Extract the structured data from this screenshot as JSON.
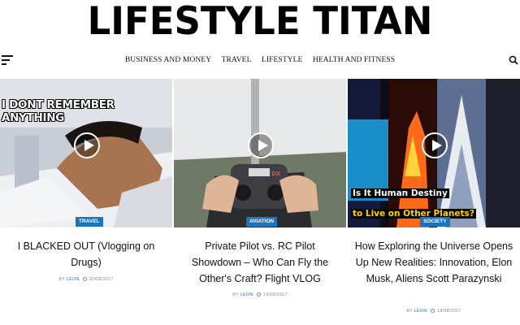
{
  "site": {
    "logo": "LIFESTYLE TITAN"
  },
  "nav": {
    "items": [
      {
        "label": "BUSINESS AND MONEY"
      },
      {
        "label": "TRAVEL"
      },
      {
        "label": "LIFESTYLE"
      },
      {
        "label": "HEALTH AND FITNESS"
      }
    ]
  },
  "icons": {
    "menu": "hamburger-menu-icon",
    "search": "search-icon",
    "play": "play-icon",
    "clock": "clock-icon"
  },
  "colors": {
    "badge": "#1e73be",
    "author": "#1e73be",
    "meta": "#888888"
  },
  "posts": [
    {
      "overlay": "I DONT REMEMBER ANYTHING",
      "category": "TRAVEL",
      "title": "I BLACKED OUT (Vlogging on Drugs)",
      "by": "BY",
      "author": "LEON",
      "date": "20/08/2017"
    },
    {
      "overlay": "DX",
      "category": "AVIATION",
      "title": "Private Pilot vs. RC Pilot Showdown – Who Can Fly the Other's Craft? Flight VLOG",
      "by": "BY",
      "author": "LEON",
      "date": "19/08/2017"
    },
    {
      "overlay_line1": "Is It Human Destiny",
      "overlay_line2": "to Live on Other Planets?",
      "category": "SOCIETY",
      "title": "How Exploring the Universe Opens Up New Realities: Innovation, Elon Musk, Aliens Scott Parazynski",
      "by": "BY",
      "author": "LEON",
      "date": "18/08/2017"
    }
  ]
}
